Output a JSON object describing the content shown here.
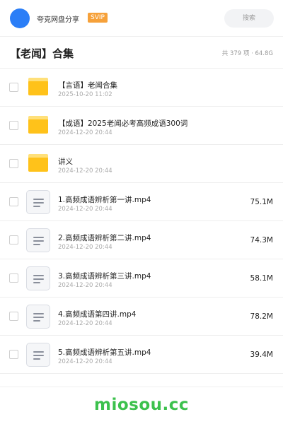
{
  "header": {
    "user_name": "夸克网盘分享",
    "badge": "SVIP",
    "search_label": "搜索",
    "accent_color": "#2b7ef7"
  },
  "folder": {
    "title": "【老闻】合集",
    "summary": "共 379 项 · 64.8G"
  },
  "files": [
    {
      "type": "folder",
      "icon": "folder-icon",
      "name": "【言语】老闻合集",
      "date": "2025-10-20 11:02",
      "size": ""
    },
    {
      "type": "folder",
      "icon": "folder-icon",
      "name": "【成语】2025老闻必考高频成语300词",
      "date": "2024-12-20 20:44",
      "size": ""
    },
    {
      "type": "folder",
      "icon": "folder-icon",
      "name": "讲义",
      "date": "2024-12-20 20:44",
      "size": ""
    },
    {
      "type": "file",
      "icon": "video-file-icon",
      "name": "1.高频成语辨析第一讲.mp4",
      "date": "2024-12-20 20:44",
      "size": "75.1M"
    },
    {
      "type": "file",
      "icon": "video-file-icon",
      "name": "2.高频成语辨析第二讲.mp4",
      "date": "2024-12-20 20:44",
      "size": "74.3M"
    },
    {
      "type": "file",
      "icon": "video-file-icon",
      "name": "3.高频成语辨析第三讲.mp4",
      "date": "2024-12-20 20:44",
      "size": "58.1M"
    },
    {
      "type": "file",
      "icon": "video-file-icon",
      "name": "4.高频成语第四讲.mp4",
      "date": "2024-12-20 20:44",
      "size": "78.2M"
    },
    {
      "type": "file",
      "icon": "video-file-icon",
      "name": "5.高频成语辨析第五讲.mp4",
      "date": "2024-12-20 20:44",
      "size": "39.4M"
    }
  ],
  "watermark": "miosou.cc"
}
